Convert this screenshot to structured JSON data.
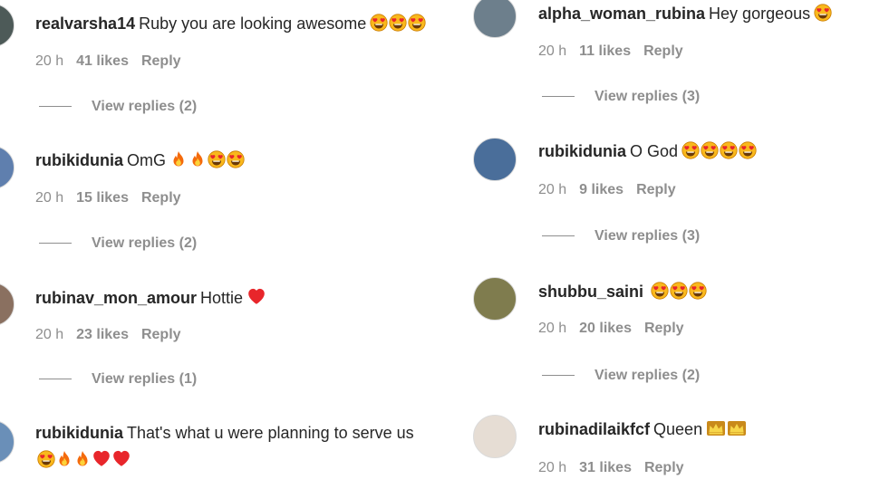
{
  "left": [
    {
      "username": "realvarsha14",
      "text": "Ruby you are looking awesome",
      "emojis": [
        "heart-eyes-emoji",
        "heart-eyes-emoji",
        "heart-eyes-emoji"
      ],
      "time": "20 h",
      "likes": "41 likes",
      "reply": "Reply",
      "view_replies": "View replies (2)"
    },
    {
      "username": "rubikidunia",
      "text": "OmG",
      "emojis": [
        "fire-emoji",
        "fire-emoji",
        "heart-eyes-emoji",
        "heart-eyes-emoji"
      ],
      "time": "20 h",
      "likes": "15 likes",
      "reply": "Reply",
      "view_replies": "View replies (2)"
    },
    {
      "username": "rubinav_mon_amour",
      "text": "Hottie",
      "emojis": [
        "red-heart-emoji"
      ],
      "time": "20 h",
      "likes": "23 likes",
      "reply": "Reply",
      "view_replies": "View replies (1)"
    },
    {
      "username": "rubikidunia",
      "text": "That's what u were planning to serve us",
      "emojis_line2": [
        "heart-eyes-emoji",
        "fire-emoji",
        "fire-emoji",
        "red-heart-emoji",
        "red-heart-emoji"
      ]
    }
  ],
  "right": [
    {
      "username": "alpha_woman_rubina",
      "text": "Hey gorgeous",
      "emojis": [
        "heart-eyes-emoji"
      ],
      "time": "20 h",
      "likes": "11 likes",
      "reply": "Reply",
      "view_replies": "View replies (3)"
    },
    {
      "username": "rubikidunia",
      "text": "O God",
      "emojis": [
        "heart-eyes-emoji",
        "heart-eyes-emoji",
        "heart-eyes-emoji",
        "heart-eyes-emoji"
      ],
      "time": "20 h",
      "likes": "9 likes",
      "reply": "Reply",
      "view_replies": "View replies (3)"
    },
    {
      "username": "shubbu_saini",
      "text": "",
      "emojis": [
        "heart-eyes-emoji",
        "heart-eyes-emoji",
        "heart-eyes-emoji"
      ],
      "time": "20 h",
      "likes": "20 likes",
      "reply": "Reply",
      "view_replies": "View replies (2)"
    },
    {
      "username": "rubinadilaikfcf",
      "text": "Queen",
      "emojis": [
        "crown-emoji",
        "crown-emoji"
      ],
      "time": "20 h",
      "likes": "31 likes",
      "reply": "Reply"
    }
  ],
  "colors": {
    "text": "#262626",
    "secondary": "#8e8e8e",
    "heart": "#ed1c24",
    "emoji_face": "#f7b500"
  }
}
